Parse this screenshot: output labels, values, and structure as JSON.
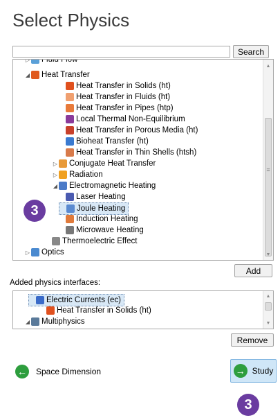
{
  "title": "Select Physics",
  "search": {
    "button_label": "Search",
    "value": ""
  },
  "tree": [
    {
      "label": "Fluid Flow",
      "arrow": "▷",
      "icon_color": "#5aa0d8",
      "icon": "fluid-flow-icon"
    },
    {
      "label": "Heat Transfer",
      "arrow": "◢",
      "icon_color": "#e05a1e",
      "icon": "heat-transfer-icon"
    },
    {
      "label": "Heat Transfer in Solids (ht)",
      "arrow": "",
      "icon_color": "#e0501e",
      "icon": "solids-heat-icon"
    },
    {
      "label": "Heat Transfer in Fluids (ht)",
      "arrow": "",
      "icon_color": "#f0a070",
      "icon": "fluids-heat-icon"
    },
    {
      "label": "Heat Transfer in Pipes (htp)",
      "arrow": "",
      "icon_color": "#e87a3a",
      "icon": "pipes-heat-icon"
    },
    {
      "label": "Local Thermal Non-Equilibrium",
      "arrow": "",
      "icon_color": "#8a3a9a",
      "icon": "thermal-noneq-icon"
    },
    {
      "label": "Heat Transfer in Porous Media (ht)",
      "arrow": "",
      "icon_color": "#c8402a",
      "icon": "porous-heat-icon"
    },
    {
      "label": "Bioheat Transfer (ht)",
      "arrow": "",
      "icon_color": "#3a7ad0",
      "icon": "bioheat-icon"
    },
    {
      "label": "Heat Transfer in Thin Shells (htsh)",
      "arrow": "",
      "icon_color": "#d87a4a",
      "icon": "thin-shells-icon"
    },
    {
      "label": "Conjugate Heat Transfer",
      "arrow": "▷",
      "icon_color": "#e89a3a",
      "icon": "conjugate-heat-icon"
    },
    {
      "label": "Radiation",
      "arrow": "▷",
      "icon_color": "#f0a020",
      "icon": "radiation-icon"
    },
    {
      "label": "Electromagnetic Heating",
      "arrow": "◢",
      "icon_color": "#4a7ac8",
      "icon": "em-heating-icon"
    },
    {
      "label": "Laser Heating",
      "arrow": "",
      "icon_color": "#4a5ab0",
      "icon": "laser-heating-icon"
    },
    {
      "label": "Joule Heating",
      "arrow": "",
      "icon_color": "#5a8ad0",
      "icon": "joule-heating-icon",
      "selected": true
    },
    {
      "label": "Induction Heating",
      "arrow": "",
      "icon_color": "#e07a3a",
      "icon": "induction-heating-icon"
    },
    {
      "label": "Microwave Heating",
      "arrow": "",
      "icon_color": "#777777",
      "icon": "microwave-heating-icon"
    },
    {
      "label": "Thermoelectric Effect",
      "arrow": "",
      "icon_color": "#888888",
      "icon": "thermoelectric-icon"
    },
    {
      "label": "Optics",
      "arrow": "▷",
      "icon_color": "#4a8ad0",
      "icon": "optics-icon"
    }
  ],
  "add_button": "Add",
  "added_label": "Added physics interfaces:",
  "added": [
    {
      "label": "Electric Currents (ec)",
      "arrow": "",
      "icon_color": "#3a6ac8",
      "icon": "electric-currents-icon",
      "selected": true
    },
    {
      "label": "Heat Transfer in Solids (ht)",
      "arrow": "",
      "icon_color": "#e0501e",
      "icon": "solids-heat-icon"
    },
    {
      "label": "Multiphysics",
      "arrow": "◢",
      "icon_color": "#5a7a9a",
      "icon": "multiphysics-icon"
    }
  ],
  "remove_button": "Remove",
  "back_button": "Space Dimension",
  "study_button": "Study",
  "badge_number": "3"
}
